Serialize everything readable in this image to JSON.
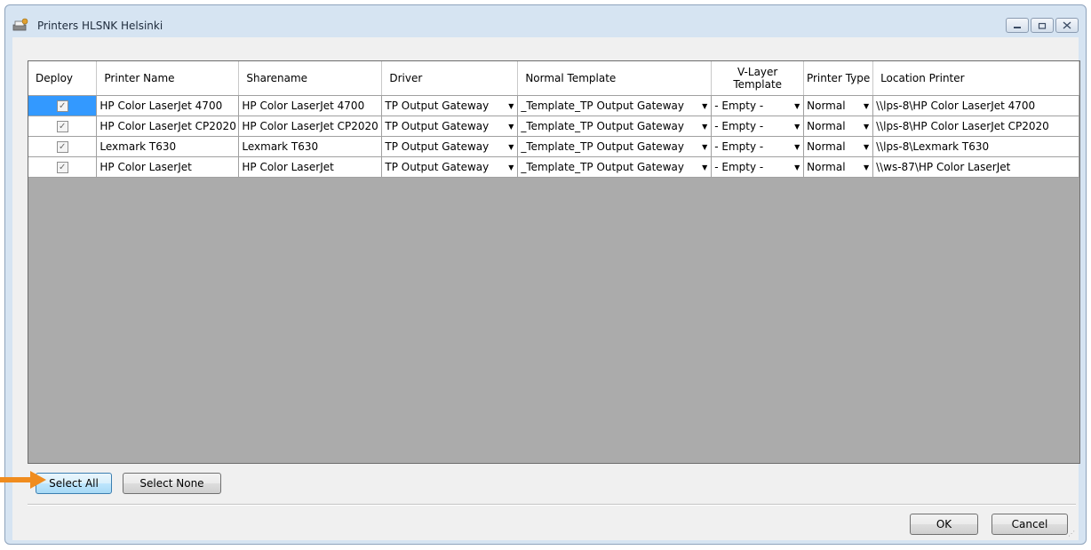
{
  "window": {
    "title": "Printers HLSNK Helsinki",
    "icon": "printer-icon"
  },
  "grid": {
    "columns": [
      "Deploy",
      "Printer Name",
      "Sharename",
      "Driver",
      "Normal Template",
      "V-Layer Template",
      "Printer Type",
      "Location Printer"
    ],
    "rows": [
      {
        "deploy": true,
        "printer_name": "HP Color LaserJet 4700",
        "sharename": "HP Color LaserJet 4700",
        "driver": "TP Output Gateway",
        "normal_template": "_Template_TP Output Gateway",
        "vlayer_template": "- Empty -",
        "printer_type": "Normal",
        "location": "\\\\lps-8\\HP Color LaserJet 4700"
      },
      {
        "deploy": true,
        "printer_name": "HP Color LaserJet CP2020",
        "sharename": "HP Color LaserJet CP2020",
        "driver": "TP Output Gateway",
        "normal_template": "_Template_TP Output Gateway",
        "vlayer_template": "- Empty -",
        "printer_type": "Normal",
        "location": "\\\\lps-8\\HP Color LaserJet CP2020"
      },
      {
        "deploy": true,
        "printer_name": "Lexmark T630",
        "sharename": "Lexmark T630",
        "driver": "TP Output Gateway",
        "normal_template": "_Template_TP Output Gateway",
        "vlayer_template": "- Empty -",
        "printer_type": "Normal",
        "location": "\\\\lps-8\\Lexmark T630"
      },
      {
        "deploy": true,
        "printer_name": "HP Color LaserJet",
        "sharename": "HP Color LaserJet",
        "driver": "TP Output Gateway",
        "normal_template": "_Template_TP Output Gateway",
        "vlayer_template": "- Empty -",
        "printer_type": "Normal",
        "location": "\\\\ws-87\\HP Color LaserJet"
      }
    ]
  },
  "buttons": {
    "select_all": "Select All",
    "select_none": "Select None",
    "ok": "OK",
    "cancel": "Cancel"
  },
  "colors": {
    "annotation_arrow": "#f08c1e",
    "selected_cell": "#3399ff",
    "empty_grid_area": "#ababab"
  }
}
